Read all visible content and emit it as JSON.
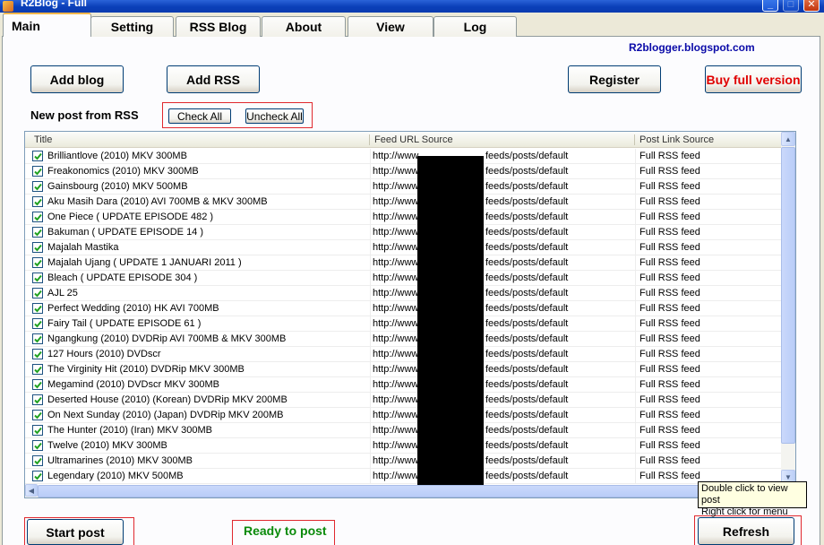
{
  "window": {
    "title": "R2Blog - Full"
  },
  "tabs": [
    {
      "label": "Main"
    },
    {
      "label": "Setting"
    },
    {
      "label": "RSS Blog"
    },
    {
      "label": "About"
    },
    {
      "label": "View"
    },
    {
      "label": "Log"
    }
  ],
  "header": {
    "site_link": "R2blogger.blogspot.com"
  },
  "toolbar": {
    "add_blog": "Add blog",
    "add_rss": "Add RSS",
    "register": "Register",
    "buy_full": "Buy full version"
  },
  "rss_section": {
    "label": "New post from RSS",
    "check_all": "Check All",
    "uncheck_all": "Uncheck All"
  },
  "table": {
    "columns": [
      "Title",
      "Feed URL Source",
      "Post Link Source"
    ],
    "rows": [
      {
        "checked": true,
        "title": "Brilliantlove (2010) MKV 300MB",
        "feed_prefix": "http://www",
        "feed_suffix": "feeds/posts/default",
        "link": "Full RSS feed"
      },
      {
        "checked": true,
        "title": "Freakonomics (2010) MKV 300MB",
        "feed_prefix": "http://www",
        "feed_suffix": "feeds/posts/default",
        "link": "Full RSS feed"
      },
      {
        "checked": true,
        "title": "Gainsbourg (2010) MKV 500MB",
        "feed_prefix": "http://www",
        "feed_suffix": "feeds/posts/default",
        "link": "Full RSS feed"
      },
      {
        "checked": true,
        "title": "Aku Masih Dara (2010) AVI 700MB & MKV 300MB",
        "feed_prefix": "http://www",
        "feed_suffix": "feeds/posts/default",
        "link": "Full RSS feed"
      },
      {
        "checked": true,
        "title": "One Piece ( UPDATE EPISODE 482 )",
        "feed_prefix": "http://www",
        "feed_suffix": "feeds/posts/default",
        "link": "Full RSS feed"
      },
      {
        "checked": true,
        "title": "Bakuman ( UPDATE EPISODE 14 )",
        "feed_prefix": "http://www",
        "feed_suffix": "feeds/posts/default",
        "link": "Full RSS feed"
      },
      {
        "checked": true,
        "title": "Majalah Mastika",
        "feed_prefix": "http://www",
        "feed_suffix": "feeds/posts/default",
        "link": "Full RSS feed"
      },
      {
        "checked": true,
        "title": "Majalah Ujang ( UPDATE 1 JANUARI 2011 )",
        "feed_prefix": "http://www",
        "feed_suffix": "feeds/posts/default",
        "link": "Full RSS feed"
      },
      {
        "checked": true,
        "title": "Bleach ( UPDATE EPISODE 304 )",
        "feed_prefix": "http://www",
        "feed_suffix": "feeds/posts/default",
        "link": "Full RSS feed"
      },
      {
        "checked": true,
        "title": "AJL 25",
        "feed_prefix": "http://www",
        "feed_suffix": "feeds/posts/default",
        "link": "Full RSS feed"
      },
      {
        "checked": true,
        "title": "Perfect Wedding (2010) HK AVI 700MB",
        "feed_prefix": "http://www",
        "feed_suffix": "feeds/posts/default",
        "link": "Full RSS feed"
      },
      {
        "checked": true,
        "title": "Fairy Tail ( UPDATE EPISODE 61 )",
        "feed_prefix": "http://www",
        "feed_suffix": "feeds/posts/default",
        "link": "Full RSS feed"
      },
      {
        "checked": true,
        "title": "Ngangkung (2010) DVDRip AVI 700MB & MKV 300MB",
        "feed_prefix": "http://www",
        "feed_suffix": "feeds/posts/default",
        "link": "Full RSS feed"
      },
      {
        "checked": true,
        "title": "127 Hours (2010) DVDscr",
        "feed_prefix": "http://www",
        "feed_suffix": "feeds/posts/default",
        "link": "Full RSS feed"
      },
      {
        "checked": true,
        "title": "The Virginity Hit (2010) DVDRip MKV 300MB",
        "feed_prefix": "http://www",
        "feed_suffix": "feeds/posts/default",
        "link": "Full RSS feed"
      },
      {
        "checked": true,
        "title": "Megamind (2010) DVDscr MKV 300MB",
        "feed_prefix": "http://www",
        "feed_suffix": "feeds/posts/default",
        "link": "Full RSS feed"
      },
      {
        "checked": true,
        "title": "Deserted House (2010) (Korean) DVDRip MKV 200MB",
        "feed_prefix": "http://www",
        "feed_suffix": "feeds/posts/default",
        "link": "Full RSS feed"
      },
      {
        "checked": true,
        "title": "On Next Sunday (2010) (Japan) DVDRip MKV 200MB",
        "feed_prefix": "http://www",
        "feed_suffix": "feeds/posts/default",
        "link": "Full RSS feed"
      },
      {
        "checked": true,
        "title": "The Hunter (2010) (Iran) MKV 300MB",
        "feed_prefix": "http://www",
        "feed_suffix": "feeds/posts/default",
        "link": "Full RSS feed"
      },
      {
        "checked": true,
        "title": "Twelve (2010) MKV 300MB",
        "feed_prefix": "http://www",
        "feed_suffix": "feeds/posts/default",
        "link": "Full RSS feed"
      },
      {
        "checked": true,
        "title": "Ultramarines (2010) MKV 300MB",
        "feed_prefix": "http://www",
        "feed_suffix": "feeds/posts/default",
        "link": "Full RSS feed"
      },
      {
        "checked": true,
        "title": "Legendary (2010) MKV 500MB",
        "feed_prefix": "http://www",
        "feed_suffix": "feeds/posts/default",
        "link": "Full RSS feed"
      }
    ]
  },
  "footer": {
    "start_post": "Start post",
    "status": "Ready to post",
    "refresh": "Refresh"
  },
  "tooltip": {
    "line1": "Double click to view post",
    "line2": "Right click for menu"
  },
  "colors": {
    "titlebar": "#0a3fb8",
    "status_green": "#0a8a0a",
    "buy_red": "#e00000",
    "highlight_red": "#e0282e",
    "link_blue": "#0a0aa8"
  },
  "icons": [
    "app-icon",
    "minimize-icon",
    "maximize-icon",
    "close-icon",
    "checkbox-checked-icon",
    "scroll-up-icon",
    "scroll-down-icon",
    "scroll-left-icon",
    "scroll-right-icon"
  ]
}
